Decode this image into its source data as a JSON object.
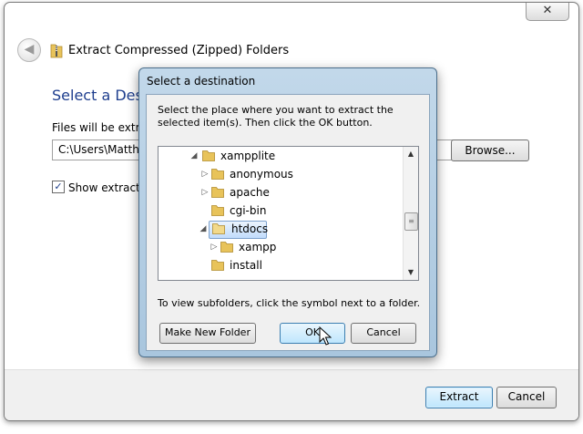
{
  "wizard": {
    "close_glyph": "✕",
    "back_glyph": "◀",
    "title": "Extract Compressed (Zipped) Folders",
    "heading": "Select a Destin",
    "files_label": "Files will be extracte",
    "path_value": "C:\\Users\\Matthew",
    "browse_label": "Browse...",
    "show_checked": "✓",
    "show_label": "Show extracted f",
    "extract_label": "Extract",
    "cancel_label": "Cancel"
  },
  "dialog": {
    "title": "Select a destination",
    "instructions": "Select the place where you want to extract the selected item(s).  Then click the OK button.",
    "tree": [
      {
        "label": "xampplite",
        "expander": "◢",
        "expanded": true
      },
      {
        "label": "anonymous",
        "expander": "▷",
        "expanded": false
      },
      {
        "label": "apache",
        "expander": "▷",
        "expanded": false
      },
      {
        "label": "cgi-bin",
        "expander": "",
        "expanded": false
      },
      {
        "label": "htdocs",
        "expander": "◢",
        "expanded": true,
        "selected": true
      },
      {
        "label": "xampp",
        "expander": "▷",
        "expanded": false
      },
      {
        "label": "install",
        "expander": "",
        "expanded": false
      }
    ],
    "scroll_up": "▲",
    "scroll_down": "▼",
    "scroll_grip": "≡",
    "hint": "To view subfolders, click the symbol next to a folder.",
    "new_folder_label": "Make New Folder",
    "ok_label": "OK",
    "cancel_label": "Cancel"
  },
  "colors": {
    "heading": "#1e3e8e",
    "dialog_frame": "#a9c6de",
    "selection": "#c1dcfc",
    "folder": "#e8c35a"
  },
  "icons": [
    "close-icon",
    "back-arrow-icon",
    "zip-folder-icon",
    "folder-icon",
    "expand-arrow-icon",
    "collapse-arrow-icon",
    "mouse-cursor-icon"
  ]
}
